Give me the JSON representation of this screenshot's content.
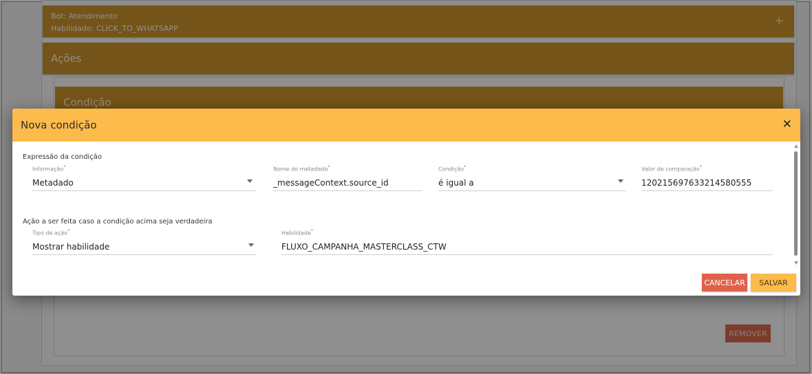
{
  "background": {
    "bot_line": "Bot: Atendimento",
    "skill_line": "Habilidade: CLICK_TO_WHATSAPP",
    "plus_icon": "+",
    "actions_title": "Ações",
    "condition_title": "Condição",
    "remove_label": "REMOVER"
  },
  "dialog": {
    "title": "Nova condição",
    "close_icon": "✕",
    "expression_section": "Expressão da condição",
    "fields": {
      "informacao": {
        "label": "Informação",
        "value": "Metadado"
      },
      "metadado": {
        "label": "Nome do metadado",
        "value": "_messageContext.source_id"
      },
      "condicao": {
        "label": "Condição",
        "value": "é igual a"
      },
      "valor": {
        "label": "Valor de comparação",
        "value": "120215697633214580555"
      }
    },
    "action_section": "Ação a ser feita caso a condição acima seja verdadeira",
    "action_fields": {
      "tipo": {
        "label": "Tipo de ação",
        "value": "Mostrar habilidade"
      },
      "habilidade": {
        "label": "Habilidade",
        "value": "FLUXO_CAMPANHA_MASTERCLASS_CTW"
      }
    },
    "cancel_label": "CANCELAR",
    "save_label": "SALVAR",
    "required_mark": "*"
  },
  "colors": {
    "header": "#fdbb4c",
    "accent_dark": "#c9922c",
    "cancel": "#e0614a"
  }
}
